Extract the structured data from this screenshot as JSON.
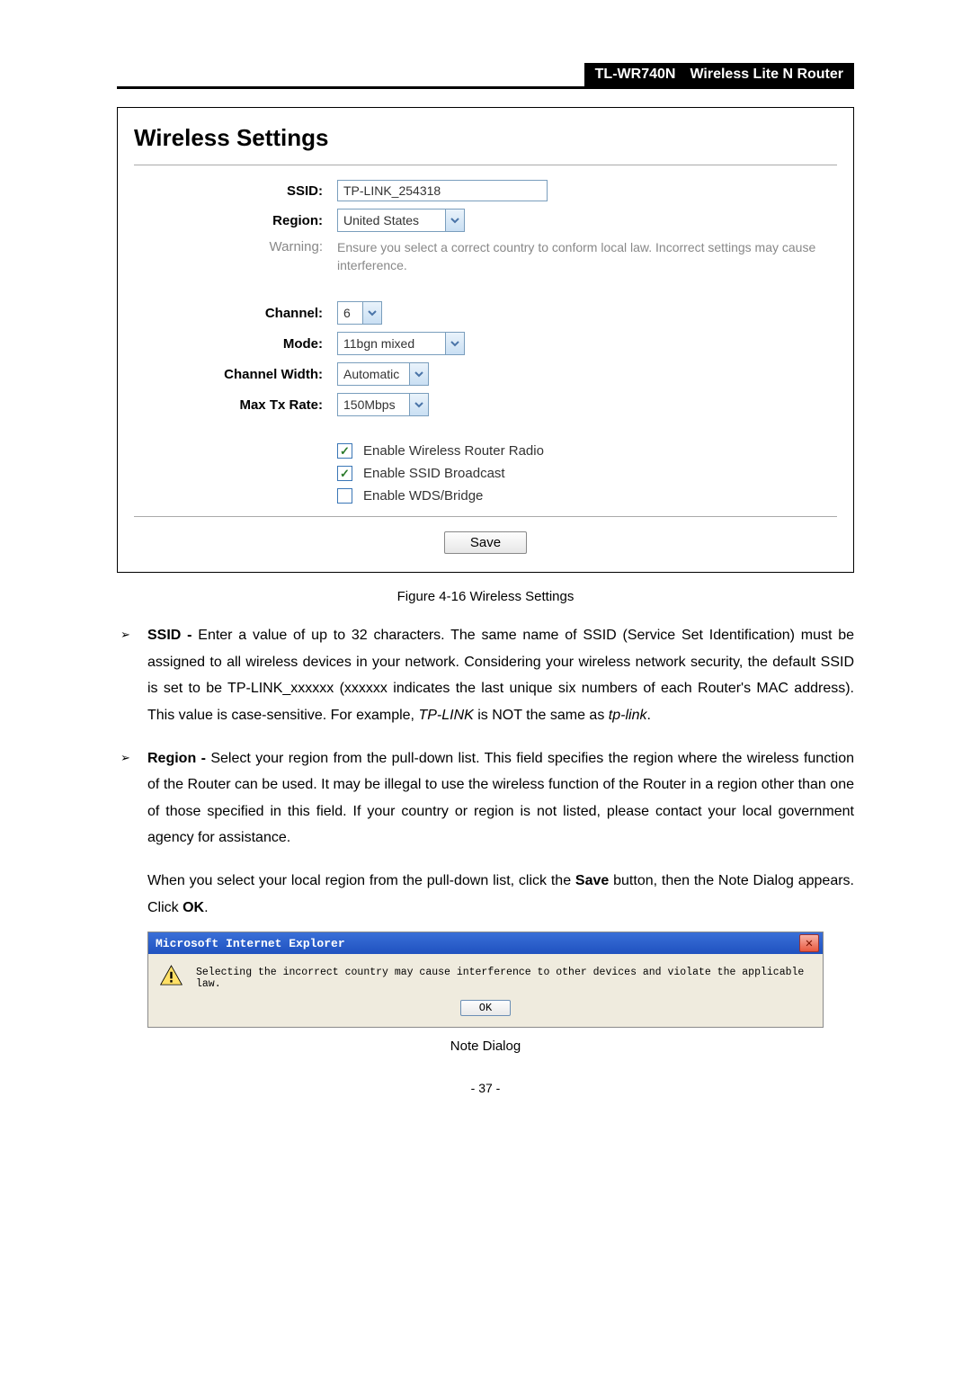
{
  "header": {
    "model": "TL-WR740N",
    "desc": "Wireless Lite N Router"
  },
  "panel": {
    "title": "Wireless Settings",
    "labels": {
      "ssid": "SSID:",
      "region": "Region:",
      "warning": "Warning:",
      "channel": "Channel:",
      "mode": "Mode:",
      "chanwidth": "Channel Width:",
      "maxrate": "Max Tx Rate:"
    },
    "values": {
      "ssid": "TP-LINK_254318",
      "region": "United States",
      "channel": "6",
      "mode": "11bgn mixed",
      "chanwidth": "Automatic",
      "maxrate": "150Mbps"
    },
    "warning_text": "Ensure you select a correct country to conform local law. Incorrect settings may cause interference.",
    "checks": {
      "radio": "Enable Wireless Router Radio",
      "ssidbc": "Enable SSID Broadcast",
      "wds": "Enable WDS/Bridge"
    },
    "save": "Save"
  },
  "figure_caption": "Figure 4-16    Wireless Settings",
  "bullets": {
    "ssid": {
      "lead": "SSID - ",
      "body": "Enter a value of up to 32 characters. The same name of SSID (Service Set Identification) must be assigned to all wireless devices in your network. Considering your wireless network security, the default SSID is set to be TP-LINK_xxxxxx (xxxxxx indicates the last unique six numbers of each Router's MAC address). This value is case-sensitive. For example, ",
      "i1": "TP-LINK",
      "mid": " is NOT the same as ",
      "i2": "tp-link",
      "end": "."
    },
    "region": {
      "lead": "Region - ",
      "body": "Select your region from the pull-down list. This field specifies the region where the wireless function of the Router can be used. It may be illegal to use the wireless function of the Router in a region other than one of those specified in this field. If your country or region is not listed, please contact your local government agency for assistance."
    }
  },
  "para": {
    "p1_a": "When you select your local region from the pull-down list, click the ",
    "p1_b": "Save",
    "p1_c": " button, then the Note Dialog appears. Click ",
    "p1_d": "OK",
    "p1_e": "."
  },
  "dialog": {
    "title": "Microsoft Internet Explorer",
    "msg": "Selecting the incorrect country may cause interference to other devices and violate the applicable law.",
    "ok": "OK"
  },
  "dialog_caption": "Note Dialog",
  "page_number": "- 37 -"
}
